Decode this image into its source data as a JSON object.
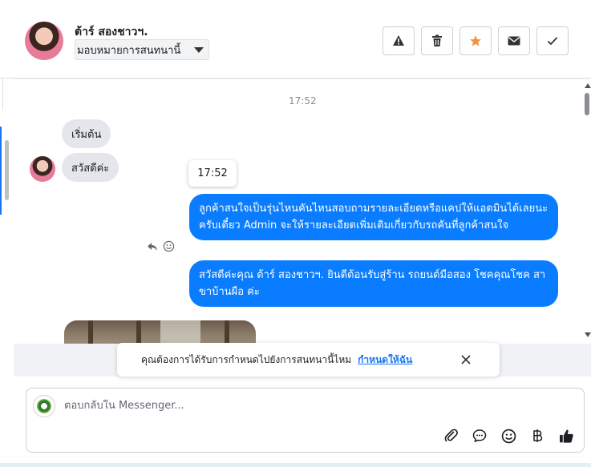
{
  "header": {
    "contact_name": "ต้าร์ สองชาวฯ.",
    "assign_label": "มอบหมายการสนทนานี้",
    "buttons": [
      {
        "name": "warning-button",
        "icon": "warning-icon"
      },
      {
        "name": "delete-button",
        "icon": "trash-icon"
      },
      {
        "name": "star-button",
        "icon": "star-icon",
        "color": "#f7923b"
      },
      {
        "name": "mail-button",
        "icon": "envelope-icon"
      },
      {
        "name": "done-button",
        "icon": "check-icon"
      }
    ]
  },
  "chat": {
    "timestamp": "17:52",
    "incoming": [
      {
        "text": "เริ่มต้น"
      },
      {
        "text": "สวัสดีค่ะ"
      }
    ],
    "tooltip_time": "17:52",
    "outgoing": [
      {
        "text": "ลูกค้าสนใจเป็นรุ่นไหนคันไหนสอบถามรายละเอียดหรือแคปให้แอดมินได้เลยนะครับเดี๋ยว Admin จะให้รายละเอียดเพิ่มเติมเกี่ยวกับรถคันที่ลูกค้าสนใจ"
      },
      {
        "text": "สวัสดีค่ะคุณ ต้าร์ สองชาวฯ. ยินดีต้อนรับสู่ร้าน รถยนต์มือสอง โชคคุณโชค สาขาบ้านผือ ค่ะ"
      }
    ],
    "outgoing_color": "#0a7cff"
  },
  "banner": {
    "text": "คุณต้องการได้รับการกำหนดไปยังการสนทนานี้ไหม",
    "link": "กำหนดให้ฉัน"
  },
  "composer": {
    "placeholder": "ตอบกลับใน Messenger...",
    "tools": [
      "paperclip-icon",
      "chat-bubble-icon",
      "emoji-icon",
      "baht-icon",
      "thumbs-up-icon"
    ]
  }
}
